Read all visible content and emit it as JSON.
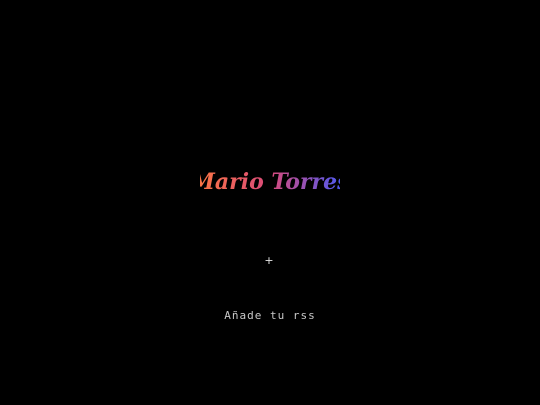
{
  "logo": {
    "text": "Mario Torres",
    "gradient_start": "#ff7a3d",
    "gradient_mid": "#d94a7a",
    "gradient_end": "#3f5bff"
  },
  "add_button": {
    "label": "+",
    "icon": "plus-icon"
  },
  "rss": {
    "label": "Añade tu rss"
  },
  "colors": {
    "background": "#000000",
    "text": "#c8c8c8"
  }
}
